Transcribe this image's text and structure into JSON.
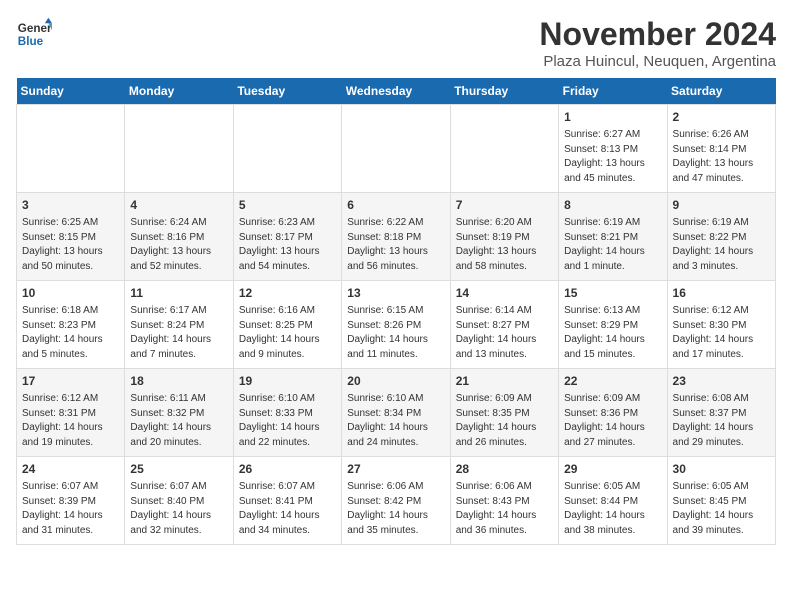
{
  "logo": {
    "line1": "General",
    "line2": "Blue"
  },
  "title": "November 2024",
  "subtitle": "Plaza Huincul, Neuquen, Argentina",
  "days_of_week": [
    "Sunday",
    "Monday",
    "Tuesday",
    "Wednesday",
    "Thursday",
    "Friday",
    "Saturday"
  ],
  "weeks": [
    [
      {
        "day": "",
        "info": ""
      },
      {
        "day": "",
        "info": ""
      },
      {
        "day": "",
        "info": ""
      },
      {
        "day": "",
        "info": ""
      },
      {
        "day": "",
        "info": ""
      },
      {
        "day": "1",
        "info": "Sunrise: 6:27 AM\nSunset: 8:13 PM\nDaylight: 13 hours\nand 45 minutes."
      },
      {
        "day": "2",
        "info": "Sunrise: 6:26 AM\nSunset: 8:14 PM\nDaylight: 13 hours\nand 47 minutes."
      }
    ],
    [
      {
        "day": "3",
        "info": "Sunrise: 6:25 AM\nSunset: 8:15 PM\nDaylight: 13 hours\nand 50 minutes."
      },
      {
        "day": "4",
        "info": "Sunrise: 6:24 AM\nSunset: 8:16 PM\nDaylight: 13 hours\nand 52 minutes."
      },
      {
        "day": "5",
        "info": "Sunrise: 6:23 AM\nSunset: 8:17 PM\nDaylight: 13 hours\nand 54 minutes."
      },
      {
        "day": "6",
        "info": "Sunrise: 6:22 AM\nSunset: 8:18 PM\nDaylight: 13 hours\nand 56 minutes."
      },
      {
        "day": "7",
        "info": "Sunrise: 6:20 AM\nSunset: 8:19 PM\nDaylight: 13 hours\nand 58 minutes."
      },
      {
        "day": "8",
        "info": "Sunrise: 6:19 AM\nSunset: 8:21 PM\nDaylight: 14 hours\nand 1 minute."
      },
      {
        "day": "9",
        "info": "Sunrise: 6:19 AM\nSunset: 8:22 PM\nDaylight: 14 hours\nand 3 minutes."
      }
    ],
    [
      {
        "day": "10",
        "info": "Sunrise: 6:18 AM\nSunset: 8:23 PM\nDaylight: 14 hours\nand 5 minutes."
      },
      {
        "day": "11",
        "info": "Sunrise: 6:17 AM\nSunset: 8:24 PM\nDaylight: 14 hours\nand 7 minutes."
      },
      {
        "day": "12",
        "info": "Sunrise: 6:16 AM\nSunset: 8:25 PM\nDaylight: 14 hours\nand 9 minutes."
      },
      {
        "day": "13",
        "info": "Sunrise: 6:15 AM\nSunset: 8:26 PM\nDaylight: 14 hours\nand 11 minutes."
      },
      {
        "day": "14",
        "info": "Sunrise: 6:14 AM\nSunset: 8:27 PM\nDaylight: 14 hours\nand 13 minutes."
      },
      {
        "day": "15",
        "info": "Sunrise: 6:13 AM\nSunset: 8:29 PM\nDaylight: 14 hours\nand 15 minutes."
      },
      {
        "day": "16",
        "info": "Sunrise: 6:12 AM\nSunset: 8:30 PM\nDaylight: 14 hours\nand 17 minutes."
      }
    ],
    [
      {
        "day": "17",
        "info": "Sunrise: 6:12 AM\nSunset: 8:31 PM\nDaylight: 14 hours\nand 19 minutes."
      },
      {
        "day": "18",
        "info": "Sunrise: 6:11 AM\nSunset: 8:32 PM\nDaylight: 14 hours\nand 20 minutes."
      },
      {
        "day": "19",
        "info": "Sunrise: 6:10 AM\nSunset: 8:33 PM\nDaylight: 14 hours\nand 22 minutes."
      },
      {
        "day": "20",
        "info": "Sunrise: 6:10 AM\nSunset: 8:34 PM\nDaylight: 14 hours\nand 24 minutes."
      },
      {
        "day": "21",
        "info": "Sunrise: 6:09 AM\nSunset: 8:35 PM\nDaylight: 14 hours\nand 26 minutes."
      },
      {
        "day": "22",
        "info": "Sunrise: 6:09 AM\nSunset: 8:36 PM\nDaylight: 14 hours\nand 27 minutes."
      },
      {
        "day": "23",
        "info": "Sunrise: 6:08 AM\nSunset: 8:37 PM\nDaylight: 14 hours\nand 29 minutes."
      }
    ],
    [
      {
        "day": "24",
        "info": "Sunrise: 6:07 AM\nSunset: 8:39 PM\nDaylight: 14 hours\nand 31 minutes."
      },
      {
        "day": "25",
        "info": "Sunrise: 6:07 AM\nSunset: 8:40 PM\nDaylight: 14 hours\nand 32 minutes."
      },
      {
        "day": "26",
        "info": "Sunrise: 6:07 AM\nSunset: 8:41 PM\nDaylight: 14 hours\nand 34 minutes."
      },
      {
        "day": "27",
        "info": "Sunrise: 6:06 AM\nSunset: 8:42 PM\nDaylight: 14 hours\nand 35 minutes."
      },
      {
        "day": "28",
        "info": "Sunrise: 6:06 AM\nSunset: 8:43 PM\nDaylight: 14 hours\nand 36 minutes."
      },
      {
        "day": "29",
        "info": "Sunrise: 6:05 AM\nSunset: 8:44 PM\nDaylight: 14 hours\nand 38 minutes."
      },
      {
        "day": "30",
        "info": "Sunrise: 6:05 AM\nSunset: 8:45 PM\nDaylight: 14 hours\nand 39 minutes."
      }
    ]
  ]
}
